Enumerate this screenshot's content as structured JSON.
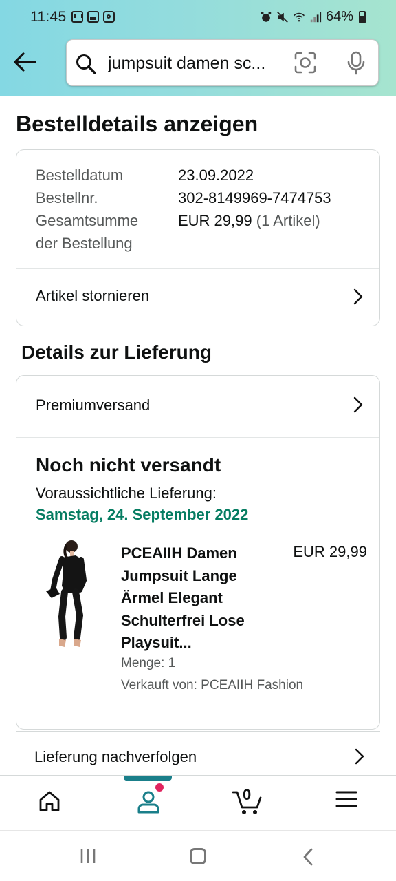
{
  "status_bar": {
    "time": "11:45",
    "battery": "64%",
    "left_icons": [
      "mail-icon",
      "image-icon",
      "app-icon"
    ],
    "right_icons": [
      "alarm-icon",
      "mute-icon",
      "wifi-icon",
      "signal-icon",
      "battery-icon"
    ]
  },
  "header": {
    "search_query": "jumpsuit damen sc...",
    "icons": [
      "back-arrow-icon",
      "search-icon",
      "camera-scan-icon",
      "microphone-icon"
    ],
    "gradient_colors": [
      "#84d8e3",
      "#a6e4cf"
    ]
  },
  "page": {
    "title": "Bestelldetails anzeigen"
  },
  "order_info": {
    "date_label": "Bestelldatum",
    "date_value": "23.09.2022",
    "number_label": "Bestellnr.",
    "number_value": "302-8149969-7474753",
    "total_label_line1": "Gesamtsumme",
    "total_label_line2": "der Bestellung",
    "total_value": "EUR 29,99",
    "total_items": "(1 Artikel)",
    "cancel_label": "Artikel stornieren"
  },
  "delivery": {
    "section_title": "Details zur Lieferung",
    "shipping_method": "Premiumversand",
    "status": "Noch nicht versandt",
    "expected_label": "Voraussichtliche Lieferung:",
    "expected_date": "Samstag, 24. September 2022",
    "expected_date_color": "#067d62",
    "track_label": "Lieferung nachverfolgen"
  },
  "product": {
    "title": "PCEAIIH Damen Jumpsuit Lange Ärmel Elegant Schulterfrei Lose Playsuit...",
    "price": "EUR 29,99",
    "quantity": "Menge: 1",
    "seller": "Verkauft von: PCEAIIH Fashion"
  },
  "bottom_nav": {
    "items": [
      "home-icon",
      "account-icon",
      "cart-icon",
      "menu-icon"
    ],
    "cart_count": "0",
    "active_color": "#1a7f8a",
    "badge_color": "#e0245e"
  }
}
